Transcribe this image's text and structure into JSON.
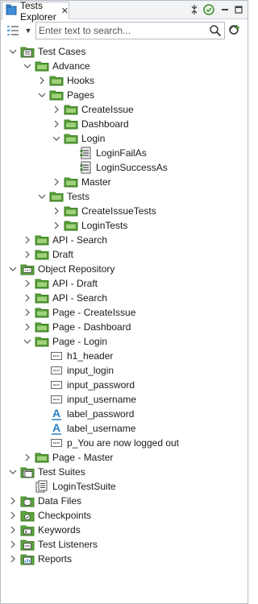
{
  "tab": {
    "label": "Tests Explorer",
    "close": "✕"
  },
  "search": {
    "placeholder": "Enter text to search..."
  },
  "tree": [
    {
      "label": "Test Cases",
      "icon": "test-cases-icon",
      "expanded": true,
      "level": 0
    },
    {
      "label": "Advance",
      "icon": "folder-icon",
      "expanded": true,
      "level": 1
    },
    {
      "label": "Hooks",
      "icon": "folder-icon",
      "expanded": false,
      "level": 2
    },
    {
      "label": "Pages",
      "icon": "folder-icon",
      "expanded": true,
      "level": 2
    },
    {
      "label": "CreateIssue",
      "icon": "folder-icon",
      "expanded": false,
      "level": 3
    },
    {
      "label": "Dashboard",
      "icon": "folder-icon",
      "expanded": false,
      "level": 3
    },
    {
      "label": "Login",
      "icon": "folder-icon",
      "expanded": true,
      "level": 3
    },
    {
      "label": "LoginFailAs",
      "icon": "test-case-icon",
      "expanded": null,
      "level": 4
    },
    {
      "label": "LoginSuccessAs",
      "icon": "test-case-icon",
      "expanded": null,
      "level": 4
    },
    {
      "label": "Master",
      "icon": "folder-icon",
      "expanded": false,
      "level": 3
    },
    {
      "label": "Tests",
      "icon": "folder-icon",
      "expanded": true,
      "level": 2
    },
    {
      "label": "CreateIssueTests",
      "icon": "folder-icon",
      "expanded": false,
      "level": 3
    },
    {
      "label": "LoginTests",
      "icon": "folder-icon",
      "expanded": false,
      "level": 3
    },
    {
      "label": "API - Search",
      "icon": "folder-icon",
      "expanded": false,
      "level": 1
    },
    {
      "label": "Draft",
      "icon": "folder-icon",
      "expanded": false,
      "level": 1
    },
    {
      "label": "Object Repository",
      "icon": "object-repository-icon",
      "expanded": true,
      "level": 0
    },
    {
      "label": "API - Draft",
      "icon": "folder-icon",
      "expanded": false,
      "level": 1
    },
    {
      "label": "API - Search",
      "icon": "folder-icon",
      "expanded": false,
      "level": 1
    },
    {
      "label": "Page - CreateIssue",
      "icon": "folder-icon",
      "expanded": false,
      "level": 1
    },
    {
      "label": "Page - Dashboard",
      "icon": "folder-icon",
      "expanded": false,
      "level": 1
    },
    {
      "label": "Page - Login",
      "icon": "folder-icon",
      "expanded": true,
      "level": 1
    },
    {
      "label": "h1_header",
      "icon": "web-element-icon",
      "expanded": null,
      "level": 2
    },
    {
      "label": "input_login",
      "icon": "web-element-icon",
      "expanded": null,
      "level": 2
    },
    {
      "label": "input_password",
      "icon": "web-element-icon",
      "expanded": null,
      "level": 2
    },
    {
      "label": "input_username",
      "icon": "web-element-icon",
      "expanded": null,
      "level": 2
    },
    {
      "label": "label_password",
      "icon": "text-element-icon",
      "expanded": null,
      "level": 2
    },
    {
      "label": "label_username",
      "icon": "text-element-icon",
      "expanded": null,
      "level": 2
    },
    {
      "label": "p_You are now logged out",
      "icon": "web-element-icon",
      "expanded": null,
      "level": 2
    },
    {
      "label": "Page - Master",
      "icon": "folder-icon",
      "expanded": false,
      "level": 1
    },
    {
      "label": "Test Suites",
      "icon": "test-suites-icon",
      "expanded": true,
      "level": 0
    },
    {
      "label": "LoginTestSuite",
      "icon": "test-suite-icon",
      "expanded": null,
      "level": 1
    },
    {
      "label": "Data Files",
      "icon": "data-files-icon",
      "expanded": false,
      "level": 0
    },
    {
      "label": "Checkpoints",
      "icon": "checkpoints-icon",
      "expanded": false,
      "level": 0
    },
    {
      "label": "Keywords",
      "icon": "keywords-icon",
      "expanded": false,
      "level": 0
    },
    {
      "label": "Test Listeners",
      "icon": "test-listeners-icon",
      "expanded": false,
      "level": 0
    },
    {
      "label": "Reports",
      "icon": "reports-icon",
      "expanded": false,
      "level": 0
    }
  ],
  "colors": {
    "folder": "#5aa63a",
    "folder_light": "#9fd27a",
    "accent_blue": "#2a7fc1"
  }
}
